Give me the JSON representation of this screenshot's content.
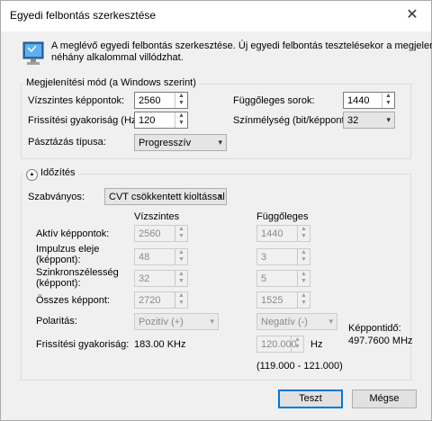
{
  "window": {
    "title": "Egyedi felbontás szerkesztése",
    "close_glyph": "✕"
  },
  "info": {
    "text_line1": "A meglévő egyedi felbontás szerkesztése. Új egyedi felbontás tesztelésekor a megjelenítő",
    "text_line2": "néhány alkalommal villódzhat.",
    "icon": "monitor-icon"
  },
  "display_mode": {
    "legend": "Megjelenítési mód (a Windows szerint)",
    "h_pixels_label": "Vízszintes képpontok:",
    "h_pixels": "2560",
    "v_lines_label": "Függőleges sorok:",
    "v_lines": "1440",
    "refresh_label": "Frissítési gyakoriság (Hz):",
    "refresh": "120",
    "color_depth_label": "Színmélység (bit/képpont):",
    "color_depth": "32",
    "scan_label": "Pásztázás típusa:",
    "scan": "Progresszív"
  },
  "timing": {
    "legend": "Időzítés",
    "toggle_glyph": "▲",
    "standard_label": "Szabványos:",
    "standard": "CVT csökkentett kioltással",
    "col_h": "Vízszintes",
    "col_v": "Függőleges",
    "rows": [
      {
        "label1": "Aktív képpontok:",
        "label2": "",
        "h": "2560",
        "v": "1440"
      },
      {
        "label1": "Impulzus eleje",
        "label2": "(képpont):",
        "h": "48",
        "v": "3"
      },
      {
        "label1": "Szinkronszélesség",
        "label2": "(képpont):",
        "h": "32",
        "v": "5"
      },
      {
        "label1": "Összes képpont:",
        "label2": "",
        "h": "2720",
        "v": "1525"
      }
    ],
    "polarity_label": "Polaritás:",
    "polarity_h": "Pozitív (+)",
    "polarity_v": "Negatív (-)",
    "refresh_label": "Frissítési gyakoriság:",
    "refresh_h": "183.00 KHz",
    "refresh_v": "120.000",
    "refresh_unit": "Hz",
    "refresh_range": "(119.000 - 121.000)",
    "pixel_clock_label": "Képpontidő:",
    "pixel_clock": "497.7600 MHz"
  },
  "buttons": {
    "test": "Teszt",
    "cancel": "Mégse"
  }
}
